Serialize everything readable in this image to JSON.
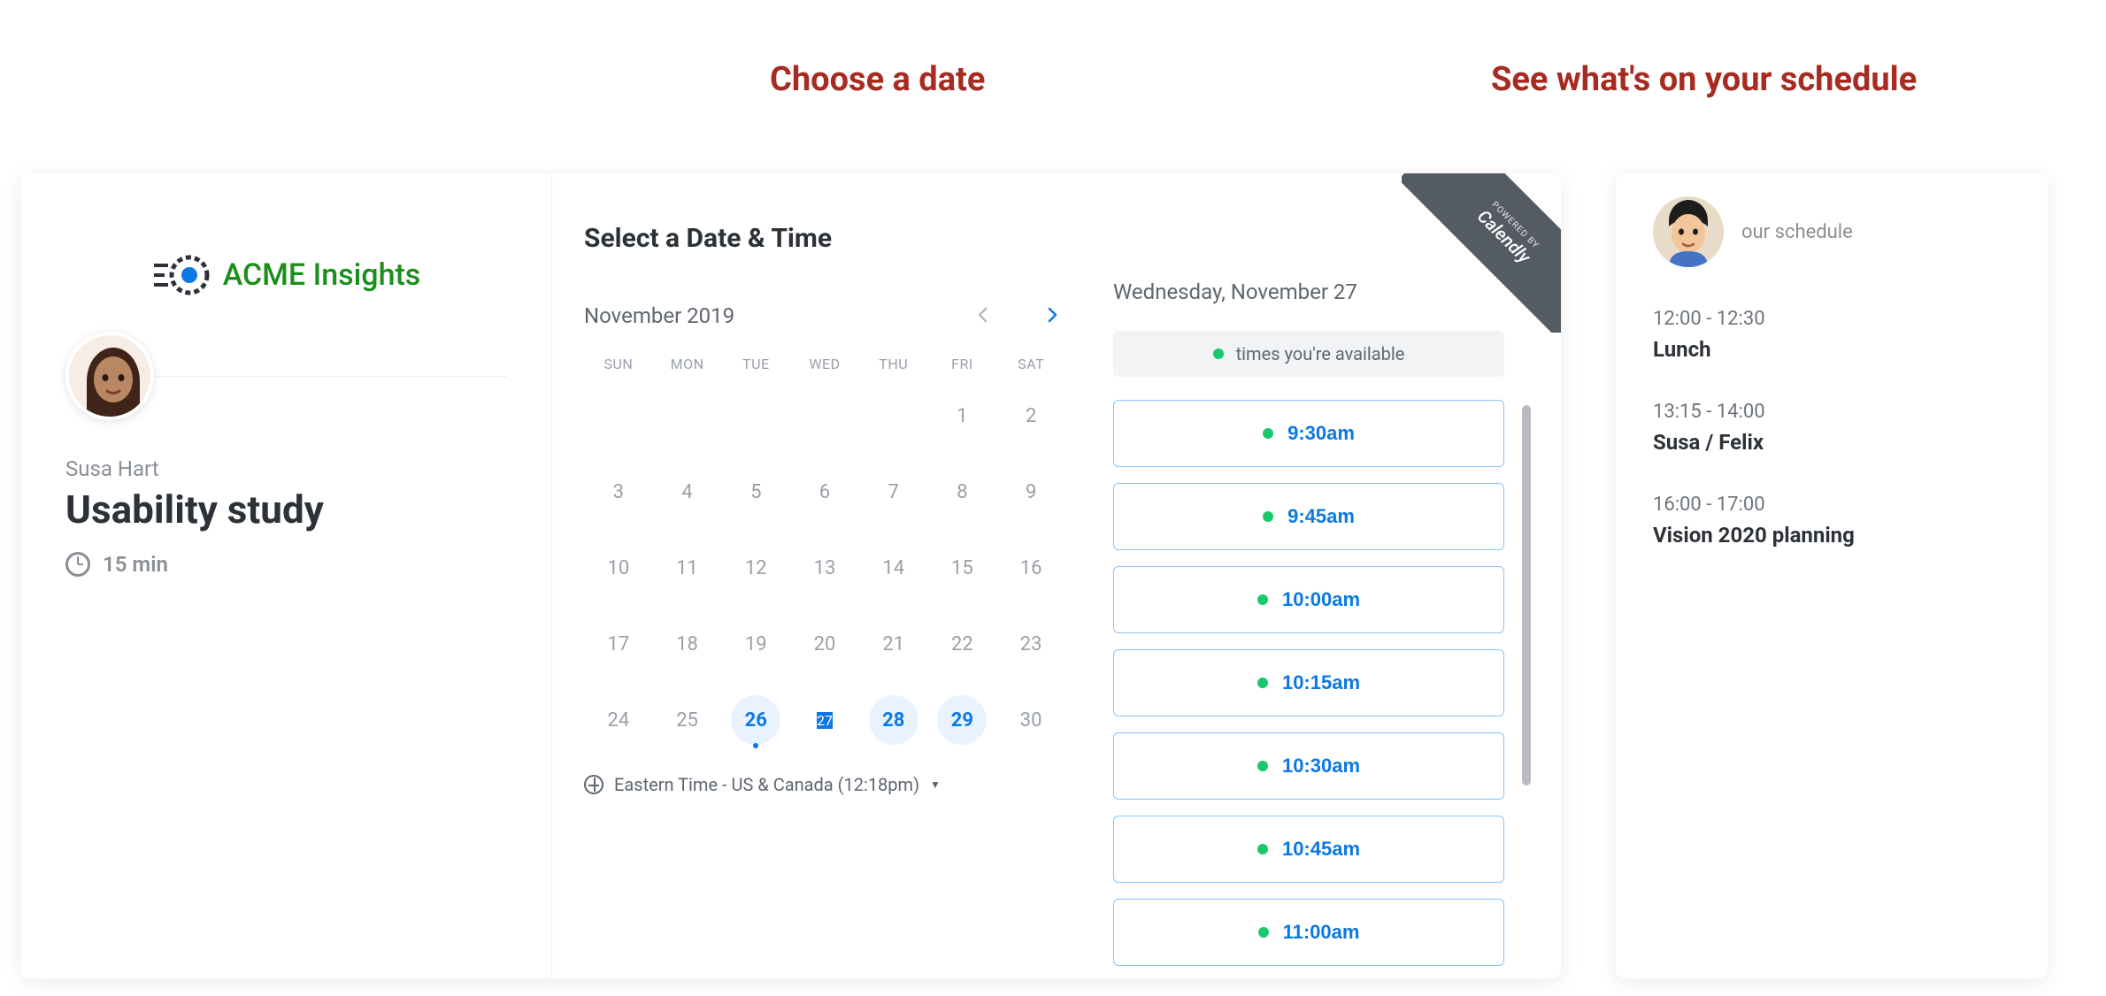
{
  "captions": {
    "choose_date": "Choose a date",
    "see_schedule": "See what's on your schedule"
  },
  "ribbon": {
    "powered_by": "POWERED BY",
    "brand": "Calendly"
  },
  "booking": {
    "brand_name": "ACME Insights",
    "host_name": "Susa Hart",
    "meeting_title": "Usability study",
    "duration": "15 min"
  },
  "calendar": {
    "select_title": "Select a Date & Time",
    "month_label": "November 2019",
    "weekdays": [
      "SUN",
      "MON",
      "TUE",
      "WED",
      "THU",
      "FRI",
      "SAT"
    ],
    "weeks": [
      [
        {
          "n": "",
          "t": "empty"
        },
        {
          "n": "",
          "t": "empty"
        },
        {
          "n": "",
          "t": "empty"
        },
        {
          "n": "",
          "t": "empty"
        },
        {
          "n": "",
          "t": "empty"
        },
        {
          "n": "1",
          "t": "disabled"
        },
        {
          "n": "2",
          "t": "disabled"
        }
      ],
      [
        {
          "n": "3",
          "t": "disabled"
        },
        {
          "n": "4",
          "t": "disabled"
        },
        {
          "n": "5",
          "t": "disabled"
        },
        {
          "n": "6",
          "t": "disabled"
        },
        {
          "n": "7",
          "t": "disabled"
        },
        {
          "n": "8",
          "t": "disabled"
        },
        {
          "n": "9",
          "t": "disabled"
        }
      ],
      [
        {
          "n": "10",
          "t": "disabled"
        },
        {
          "n": "11",
          "t": "disabled"
        },
        {
          "n": "12",
          "t": "disabled"
        },
        {
          "n": "13",
          "t": "disabled"
        },
        {
          "n": "14",
          "t": "disabled"
        },
        {
          "n": "15",
          "t": "disabled"
        },
        {
          "n": "16",
          "t": "disabled"
        }
      ],
      [
        {
          "n": "17",
          "t": "disabled"
        },
        {
          "n": "18",
          "t": "disabled"
        },
        {
          "n": "19",
          "t": "disabled"
        },
        {
          "n": "20",
          "t": "disabled"
        },
        {
          "n": "21",
          "t": "disabled"
        },
        {
          "n": "22",
          "t": "disabled"
        },
        {
          "n": "23",
          "t": "disabled"
        }
      ],
      [
        {
          "n": "24",
          "t": "disabled"
        },
        {
          "n": "25",
          "t": "disabled"
        },
        {
          "n": "26",
          "t": "available",
          "today": true
        },
        {
          "n": "27",
          "t": "selected"
        },
        {
          "n": "28",
          "t": "available"
        },
        {
          "n": "29",
          "t": "available"
        },
        {
          "n": "30",
          "t": "disabled"
        }
      ]
    ],
    "timezone_label": "Eastern Time - US & Canada (12:18pm)"
  },
  "slots": {
    "selected_date": "Wednesday, November 27",
    "availability_label": "times you're available",
    "times": [
      "9:30am",
      "9:45am",
      "10:00am",
      "10:15am",
      "10:30am",
      "10:45am",
      "11:00am"
    ]
  },
  "schedule": {
    "title": "our schedule",
    "events": [
      {
        "time": "12:00 - 12:30",
        "name": "Lunch"
      },
      {
        "time": "13:15 - 14:00",
        "name": "Susa / Felix"
      },
      {
        "time": "16:00 - 17:00",
        "name": "Vision 2020 planning"
      }
    ]
  }
}
